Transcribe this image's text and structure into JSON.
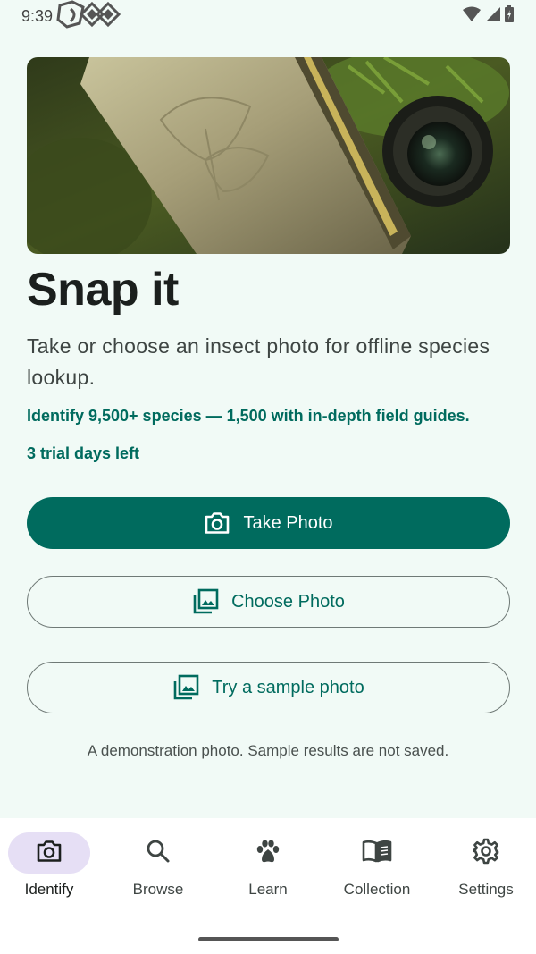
{
  "status_bar": {
    "time": "9:39",
    "icons": [
      "app-logo-icon",
      "wifi-icon",
      "signal-icon",
      "battery-icon"
    ]
  },
  "hero": {
    "icon": "hero-image"
  },
  "main": {
    "title": "Snap it",
    "subtitle": "Take or choose an insect photo for offline species lookup.",
    "feature_text": "Identify 9,500+ species — 1,500 with in-depth field guides.",
    "trial_text": "3 trial days left",
    "note": "A demonstration photo. Sample results are not saved."
  },
  "buttons": {
    "take_photo": {
      "label": "Take Photo",
      "icon": "camera-icon"
    },
    "choose_photo": {
      "label": "Choose Photo",
      "icon": "photo-library-icon"
    },
    "sample_photo": {
      "label": "Try a sample photo",
      "icon": "photo-library-icon"
    }
  },
  "nav": {
    "items": [
      {
        "label": "Identify",
        "icon": "camera-icon",
        "active": true
      },
      {
        "label": "Browse",
        "icon": "search-icon",
        "active": false
      },
      {
        "label": "Learn",
        "icon": "paw-icon",
        "active": false
      },
      {
        "label": "Collection",
        "icon": "book-icon",
        "active": false
      },
      {
        "label": "Settings",
        "icon": "gear-icon",
        "active": false
      }
    ]
  },
  "colors": {
    "background": "#f1faf6",
    "primary": "#006b5e",
    "nav_active_pill": "#e6dff5",
    "title": "#1b1f1d"
  }
}
